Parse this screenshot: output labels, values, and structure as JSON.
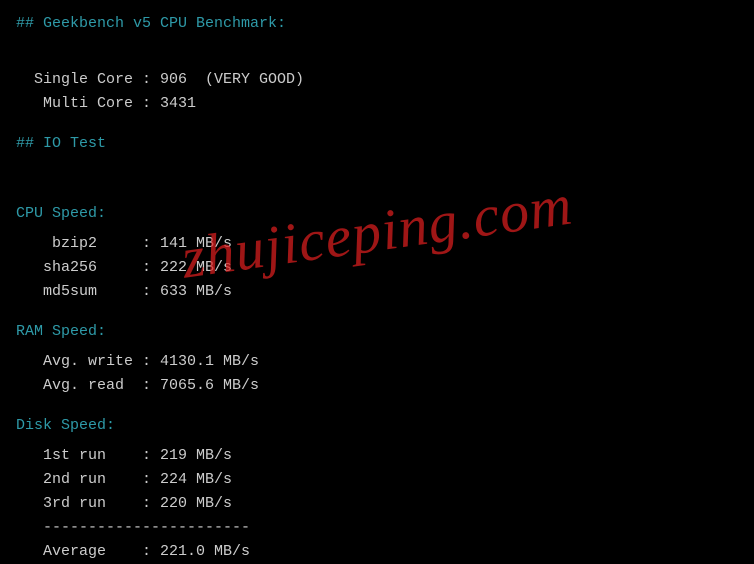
{
  "geekbench": {
    "header": "## Geekbench v5 CPU Benchmark:",
    "single_line": "  Single Core : 906  (VERY GOOD)",
    "multi_line": "   Multi Core : 3431"
  },
  "io_header": "## IO Test",
  "cpu": {
    "header": "CPU Speed:",
    "bzip2": "    bzip2     : 141 MB/s",
    "sha256": "   sha256     : 222 MB/s",
    "md5sum": "   md5sum     : 633 MB/s"
  },
  "ram": {
    "header": "RAM Speed:",
    "write": "   Avg. write : 4130.1 MB/s",
    "read": "   Avg. read  : 7065.6 MB/s"
  },
  "disk": {
    "header": "Disk Speed:",
    "run1": "   1st run    : 219 MB/s",
    "run2": "   2nd run    : 224 MB/s",
    "run3": "   3rd run    : 220 MB/s",
    "divider": "   -----------------------",
    "avg": "   Average    : 221.0 MB/s"
  },
  "watermark": "zhujiceping.com",
  "chart_data": {
    "type": "table",
    "title": "Server Benchmark Results",
    "geekbench_v5": {
      "single_core": 906,
      "single_core_rating": "VERY GOOD",
      "multi_core": 3431
    },
    "cpu_speed_MBps": {
      "bzip2": 141,
      "sha256": 222,
      "md5sum": 633
    },
    "ram_speed_MBps": {
      "avg_write": 4130.1,
      "avg_read": 7065.6
    },
    "disk_speed_MBps": {
      "run1": 219,
      "run2": 224,
      "run3": 220,
      "average": 221.0
    }
  }
}
